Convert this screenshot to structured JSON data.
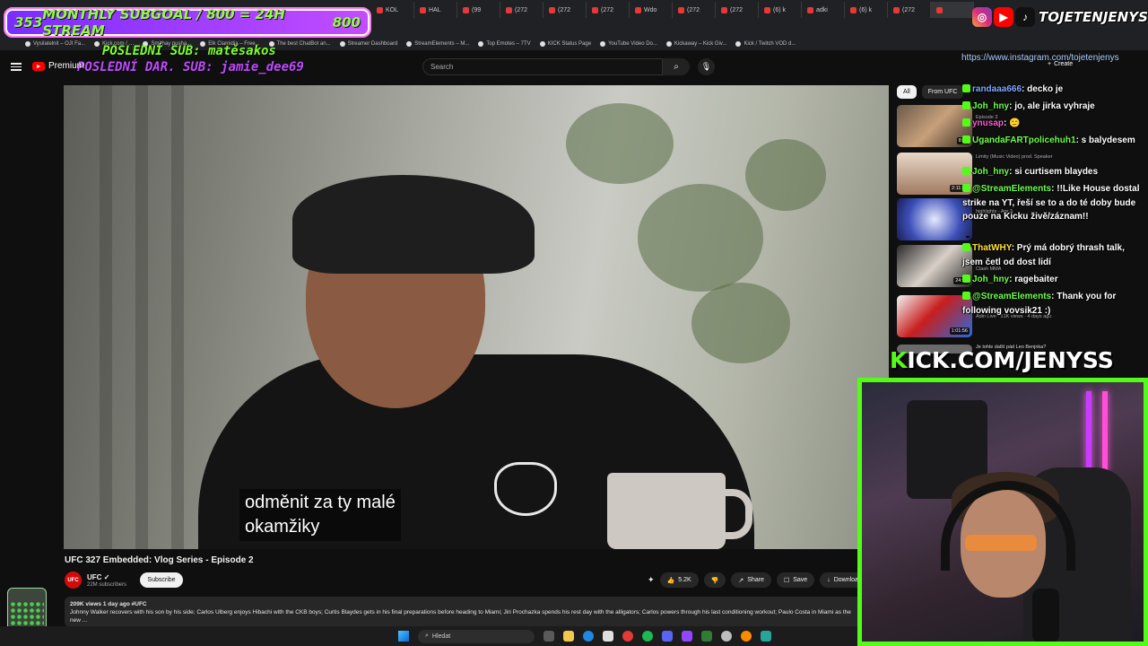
{
  "browser": {
    "tabs": [
      "KOL",
      "HAL",
      "(99",
      "(272",
      "(272",
      "(272",
      "Wdo",
      "(272",
      "(272",
      "(6) k",
      "adki",
      "(6) k",
      "(272",
      ""
    ]
  },
  "bookmarks": [
    "Vysilatelnit – OJI Fa...",
    "Kick.com / …",
    "Smithay pusha...",
    "Elk Clamidia – Free...",
    "The best ChatBot an...",
    "Streamer Dashboard",
    "StreamElements – M...",
    "Top Emotes – 7TV",
    "KICK Status Page",
    "YouTube Video Do...",
    "Kickaway – Kick Giv...",
    "Kick / Twitch VOD d..."
  ],
  "overlay": {
    "subgoal_count": "353",
    "subgoal_text": "MONTHLY SUBGOAL / 800 = 24H STREAM",
    "subgoal_target": "800",
    "last_sub": "POSLEDNÍ SUB: matěsakos",
    "last_donation": "POSLEDNÍ DAR. SUB: jamie_dee69",
    "handle": "TOJETENJENYS",
    "instagram_url": "https://www.instagram.com/tojetenjenys",
    "kick_url_k": "K",
    "kick_url_rest": "ICK.COM/JENYSS"
  },
  "youtube": {
    "brand": "Premium",
    "search_placeholder": "Search",
    "create_label": "Create",
    "video_title": "UFC 327 Embedded: Vlog Series - Episode 2",
    "channel_name": "UFC",
    "channel_subs": "22M subscribers",
    "subscribe_label": "Subscribe",
    "likes": "5.2K",
    "share_label": "Share",
    "save_label": "Save",
    "download_label": "Download",
    "views_date": "209K views  1 day ago  #UFC",
    "description": "Johnny Walker recovers with his son by his side; Carlos Ulberg enjoys Hibachi with the CKB boys; Curtis Blaydes gets in his final preparations before heading to Miami; Jiri Prochazka spends his rest day with the alligators; Carlos powers through his last conditioning workout; Paulo Costa in Miami as the new ...",
    "subtitle_line1": "odměnit za ty malé",
    "subtitle_line2": "okamžiky",
    "chip_all": "All",
    "chip_from": "From UFC",
    "recs": [
      {
        "duration": "8:11",
        "meta": "Episode 3"
      },
      {
        "duration": "2:11:31",
        "meta": "Limity (Music Video) prod. Speaker"
      },
      {
        "duration": "",
        "meta": "highlights - Apr 3"
      },
      {
        "duration": "24:33",
        "meta": "Clash MMA"
      },
      {
        "duration": "1:01:56",
        "meta": "Adin Live · 51K views · 4 days ago"
      }
    ],
    "rec_last_title": "Je tohle další pád Leo Benjnka?"
  },
  "chat": [
    {
      "user": "randaaa666",
      "text": ": decko je"
    },
    {
      "user": "Joh_hny",
      "text": ": jo, ale jirka vyhraje",
      "green": true
    },
    {
      "user": "ynusap",
      "text": ": 🙂"
    },
    {
      "user": "UgandaFARTpolicehuh1",
      "text": ": s balydesem",
      "green": true
    },
    {
      "user": "Joh_hny",
      "text": ": si curtisem blaydes",
      "green": true
    },
    {
      "user": "@StreamElements",
      "text": ": !!Like House dostal strike na YT, řeší se to a do té doby bude pouze na Kicku živě/záznam!!",
      "green": true
    },
    {
      "user": "ThatWHY",
      "text": ": Prý má dobrý thrash talk, jsem četl od dost lidí"
    },
    {
      "user": "Joh_hny",
      "text": ": ragebaiter",
      "green": true
    },
    {
      "user": "@StreamElements",
      "text": ": Thank you for following vovsik21 :)",
      "green": true
    }
  ],
  "taskbar": {
    "search_label": "Hledat"
  },
  "colors": {
    "kick_green": "#53fc18",
    "youtube_red": "#ff0000",
    "subgoal_purple": "#7a2cff"
  }
}
